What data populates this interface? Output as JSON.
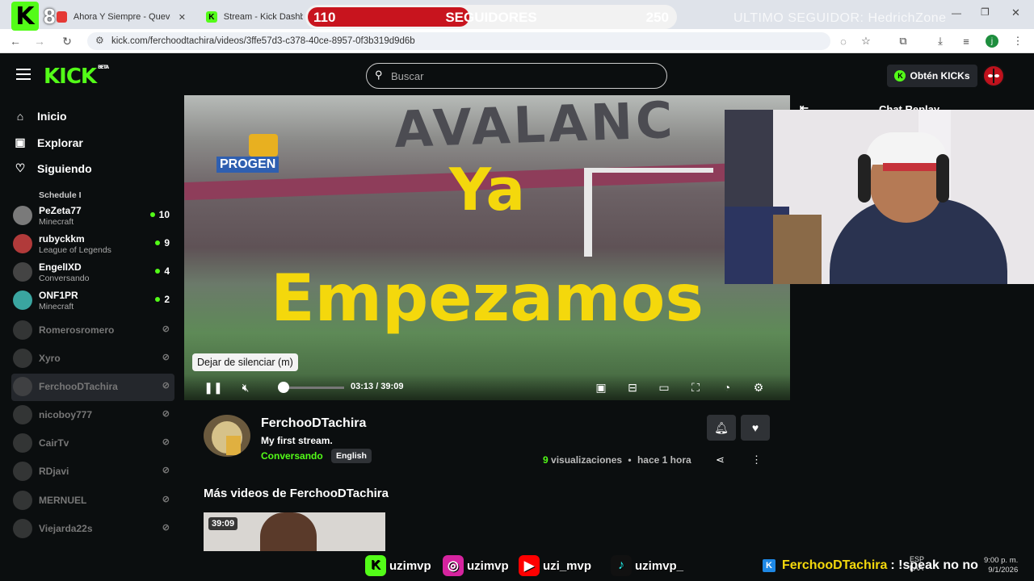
{
  "browser": {
    "tabs": [
      {
        "title": "Ahora Y Siempre - Quevedo, La"
      },
      {
        "title": "Stream - Kick Dashbo"
      }
    ],
    "url": "kick.com/ferchoodtachira/videos/3ffe57d3-c378-40ce-8957-0f3b319d9d6b",
    "profile_initial": "j"
  },
  "overlay": {
    "k_label": "K",
    "k_number": "8",
    "goal_current": "110",
    "goal_label": "SEGUIDORES",
    "goal_target": "250",
    "goal_progress": 0.44,
    "last_follower": "ULTIMO SEGUIDOR: HedrichZone",
    "socials": [
      {
        "handle": "uzimvp",
        "icon": "kick-icon",
        "color": "#53fc18"
      },
      {
        "handle": "uzimvp",
        "icon": "instagram-icon",
        "color": "#d6249f"
      },
      {
        "handle": "uzi_mvp",
        "icon": "youtube-icon",
        "color": "#ff0000"
      },
      {
        "handle": "uzimvp_",
        "icon": "tiktok-icon",
        "color": "#111111"
      }
    ],
    "ticker_name": "FerchooDTachira",
    "ticker_text": ": !speak no no",
    "tray_lang": "ESP",
    "tray_lang2": "LAA",
    "clock_time": "9:00 p. m.",
    "clock_date": "9/1/2026"
  },
  "header": {
    "logo": "KICK",
    "logo_badge": "BETA",
    "search_placeholder": "Buscar",
    "kicks_button": "Obtén KICKs",
    "kicks_icon": "K"
  },
  "sidebar": {
    "nav": [
      {
        "label": "Inicio",
        "icon": "home-icon"
      },
      {
        "label": "Explorar",
        "icon": "explore-icon"
      },
      {
        "label": "Siguiendo",
        "icon": "heart-icon"
      }
    ],
    "channels_top_label": "Schedule I",
    "channels": [
      {
        "name": "PeZeta77",
        "category": "Minecraft",
        "viewers": "10",
        "live": true
      },
      {
        "name": "rubyckkm",
        "category": "League of Legends",
        "viewers": "9",
        "live": true
      },
      {
        "name": "EngelIXD",
        "category": "Conversando",
        "viewers": "4",
        "live": true
      },
      {
        "name": "ONF1PR",
        "category": "Minecraft",
        "viewers": "2",
        "live": true
      },
      {
        "name": "Romerosromero",
        "live": false
      },
      {
        "name": "Xyro",
        "live": false
      },
      {
        "name": "FerchooDTachira",
        "live": false,
        "selected": true
      },
      {
        "name": "nicoboy777",
        "live": false
      },
      {
        "name": "CairTv",
        "live": false
      },
      {
        "name": "RDjavi",
        "live": false
      },
      {
        "name": "MERNUEL",
        "live": false
      },
      {
        "name": "Viejarda22s",
        "live": false
      }
    ]
  },
  "video": {
    "text_line1": "Ya",
    "text_line2": "Empezamos",
    "bg_text": "AVALANC",
    "bug_text": "PROGEN",
    "tooltip": "Dejar de silenciar (m)",
    "current_time": "03:13",
    "duration": "39:09",
    "time_display": "03:13 / 39:09",
    "progress": 0.08
  },
  "chat": {
    "title": "Chat Replay"
  },
  "info": {
    "streamer": "FerchooDTachira",
    "title": "My first stream.",
    "category": "Conversando",
    "language": "English",
    "views_count": "9",
    "views_label": "visualizaciones",
    "time_ago": "hace 1 hora",
    "more_videos_title": "Más videos de FerchooDTachira",
    "thumb_duration": "39:09"
  }
}
